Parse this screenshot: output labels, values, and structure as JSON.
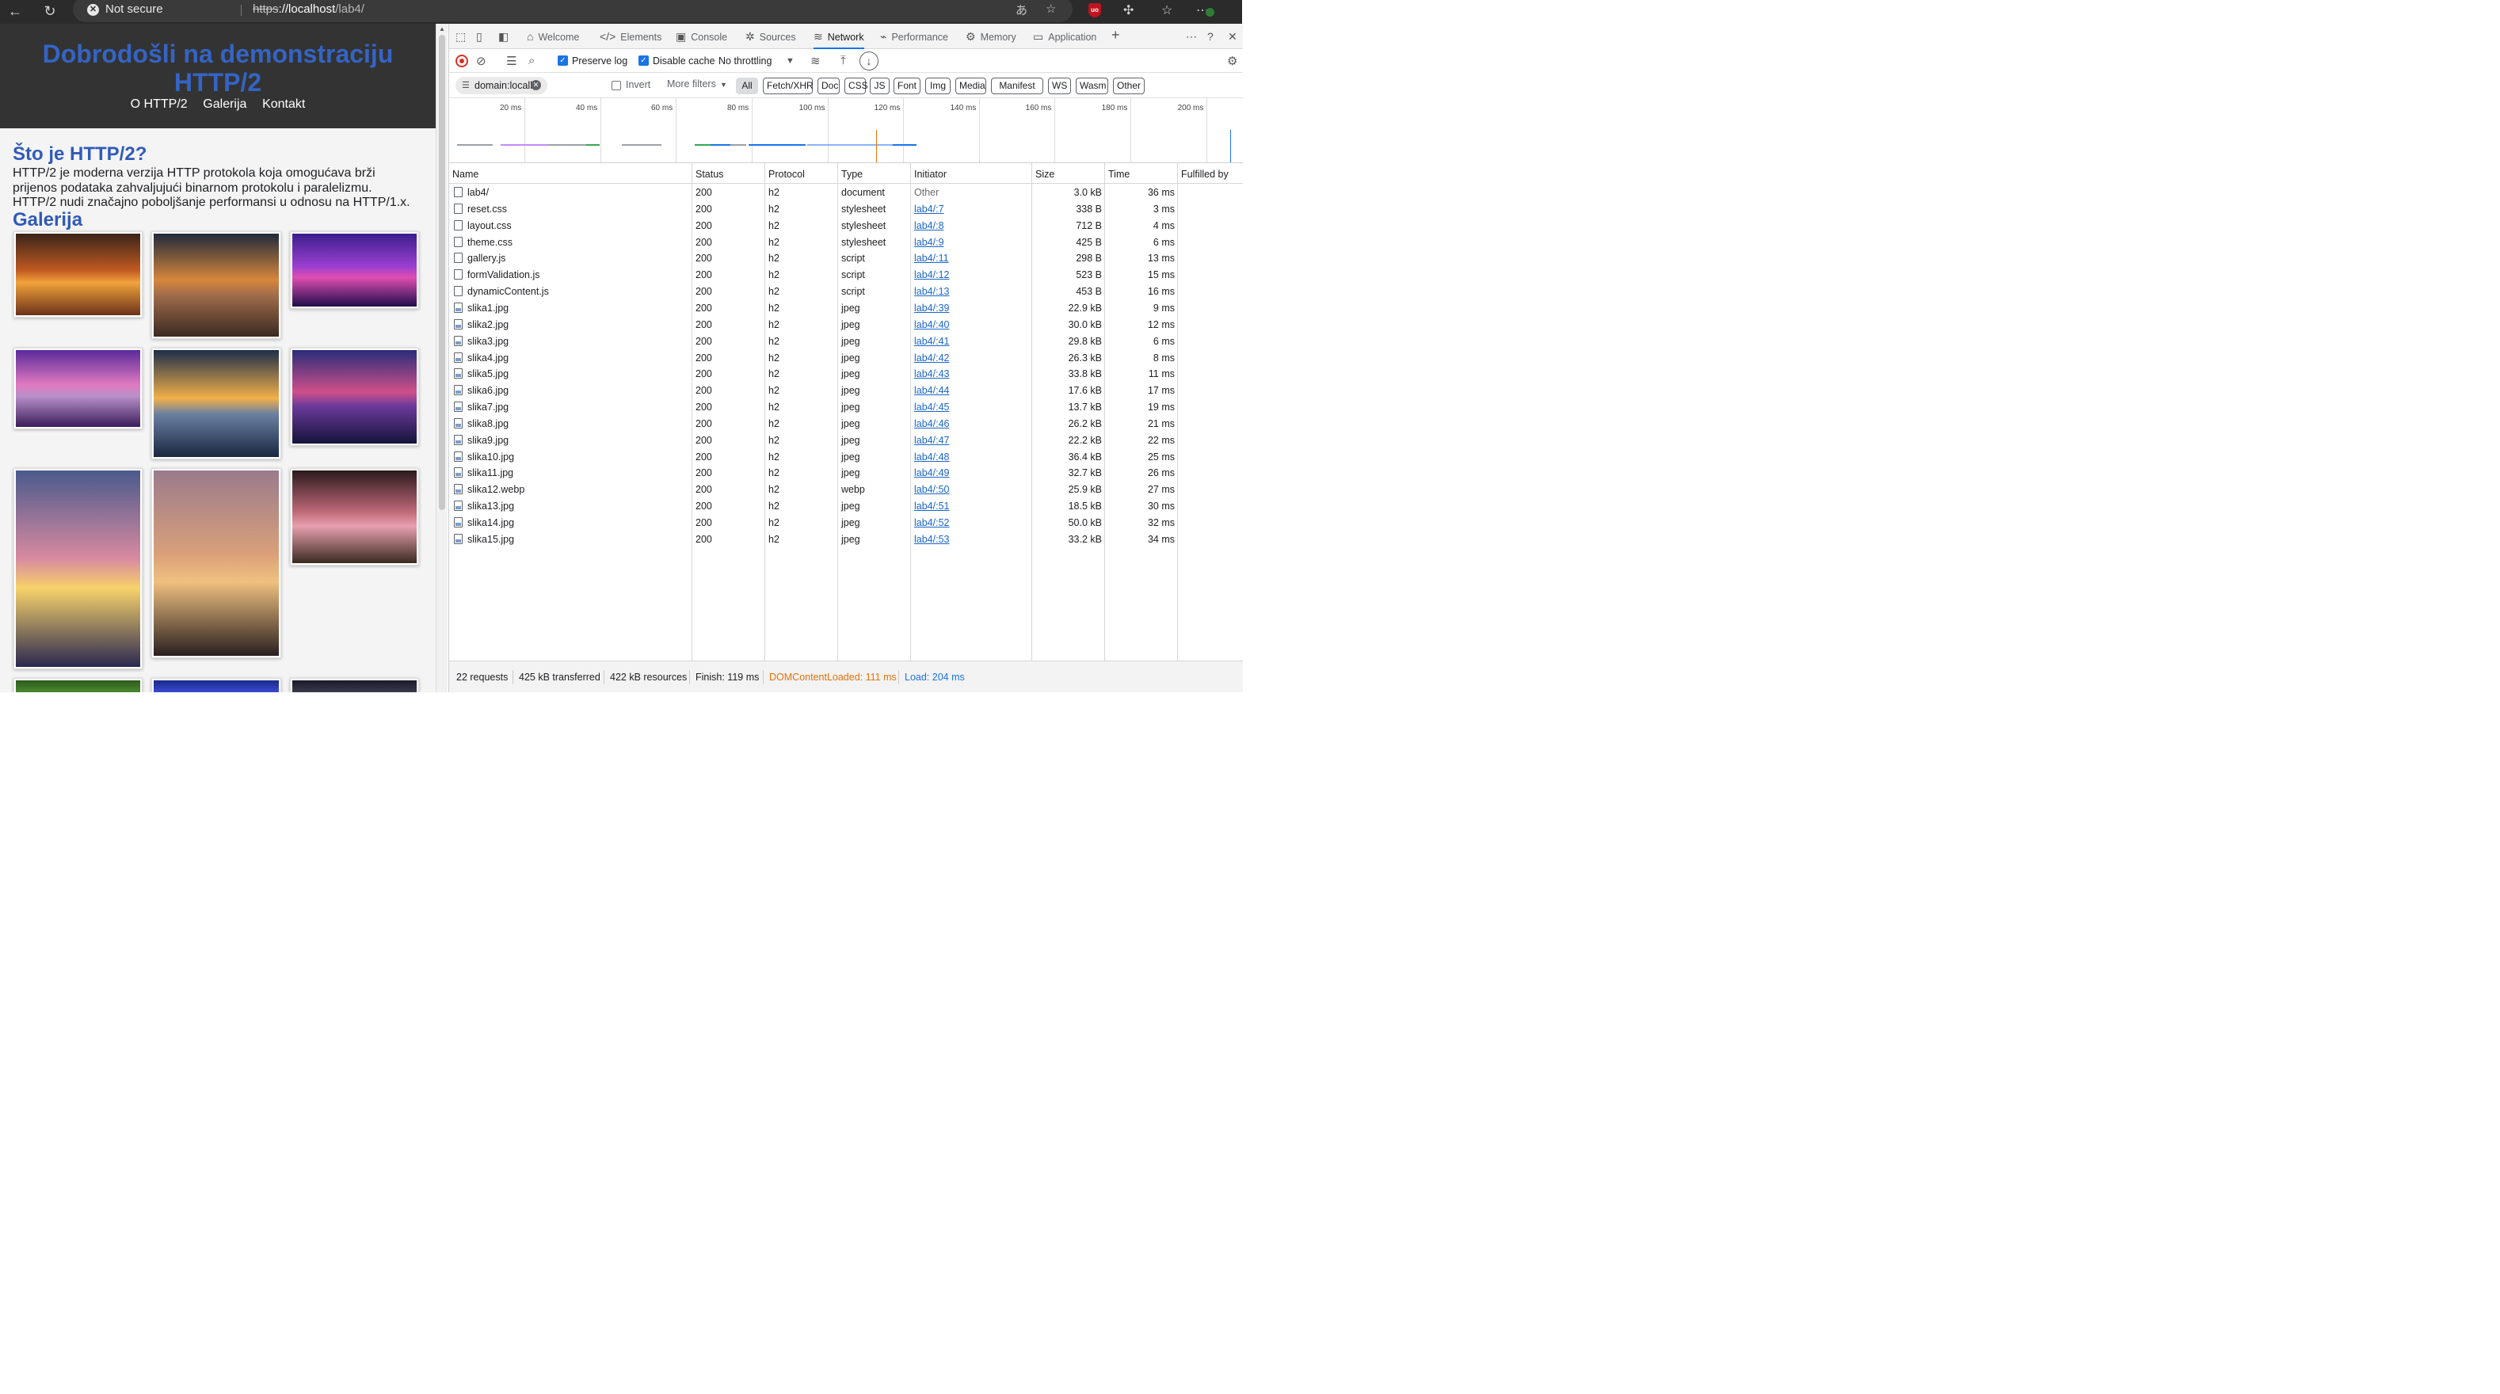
{
  "browser": {
    "security_label": "Not secure",
    "url_scheme": "https",
    "url_host": "://localhost",
    "url_path": "/lab4/",
    "translate_icon": "あ"
  },
  "site": {
    "title": "Dobrodošli na demonstraciju HTTP/2",
    "nav": [
      "O HTTP/2",
      "Galerija",
      "Kontakt"
    ],
    "section1_title": "Što je HTTP/2?",
    "section1_text": "HTTP/2 je moderna verzija HTTP protokola koja omogućava brži prijenos podataka zahvaljujući binarnom protokolu i paralelizmu. HTTP/2 nudi značajno poboljšanje performansi u odnosu na HTTP/1.x.",
    "section2_title": "Galerija",
    "gallery": [
      {
        "name": "gallery-image-sunset-valley",
        "colors": [
          "#3a2418",
          "#c15a22",
          "#f1a23c",
          "#6b3219"
        ]
      },
      {
        "name": "gallery-image-sunset-beach-rock",
        "colors": [
          "#1f2a3a",
          "#d8863c",
          "#9e6c4a",
          "#3b2a22"
        ]
      },
      {
        "name": "gallery-image-purple-tree",
        "colors": [
          "#3b1f8c",
          "#9b3fd1",
          "#e04eb3",
          "#1e0d4a"
        ]
      },
      {
        "name": "gallery-image-purple-beach",
        "colors": [
          "#5a2a9a",
          "#e07ac0",
          "#b890c8",
          "#3a1d5a"
        ]
      },
      {
        "name": "gallery-image-sunset-waves",
        "colors": [
          "#1d2e4a",
          "#f2b04a",
          "#6a7fa2",
          "#1a2840"
        ]
      },
      {
        "name": "gallery-image-purple-palm",
        "colors": [
          "#2a2c7a",
          "#d0508a",
          "#6a3a9a",
          "#14143a"
        ]
      },
      {
        "name": "gallery-image-sun-clouds",
        "colors": [
          "#4a5a8c",
          "#d88aa0",
          "#f7d26a",
          "#2a2850"
        ]
      },
      {
        "name": "gallery-image-tree-silhouette",
        "colors": [
          "#9a7a8c",
          "#d9a07a",
          "#f0c080",
          "#2a2020"
        ]
      },
      {
        "name": "gallery-image-rose",
        "colors": [
          "#2a1a1c",
          "#c06a7a",
          "#e8a0ae",
          "#3a2a20"
        ]
      }
    ]
  },
  "devtools": {
    "tabs": [
      {
        "label": "Welcome",
        "icon": "⌂"
      },
      {
        "label": "Elements",
        "icon": "</>"
      },
      {
        "label": "Console",
        "icon": "▣"
      },
      {
        "label": "Sources",
        "icon": "✲"
      },
      {
        "label": "Network",
        "icon": "≋"
      },
      {
        "label": "Performance",
        "icon": "⌁"
      },
      {
        "label": "Memory",
        "icon": "⚙"
      },
      {
        "label": "Application",
        "icon": "▭"
      }
    ],
    "active_tab": "Network",
    "toolbar": {
      "preserve_log": "Preserve log",
      "disable_cache": "Disable cache",
      "throttling": "No throttling"
    },
    "filter": {
      "value": "domain:locall",
      "invert": "Invert",
      "more_filters": "More filters",
      "types": [
        "All",
        "Fetch/XHR",
        "Doc",
        "CSS",
        "JS",
        "Font",
        "Img",
        "Media",
        "Manifest",
        "WS",
        "Wasm",
        "Other"
      ]
    },
    "timeline_labels": [
      "20 ms",
      "40 ms",
      "60 ms",
      "80 ms",
      "100 ms",
      "120 ms",
      "140 ms",
      "160 ms",
      "180 ms",
      "200 ms"
    ],
    "columns": [
      "Name",
      "Status",
      "Protocol",
      "Type",
      "Initiator",
      "Size",
      "Time",
      "Fulfilled by"
    ],
    "requests": [
      {
        "name": "lab4/",
        "status": "200",
        "protocol": "h2",
        "type": "document",
        "initiator": "Other",
        "size": "3.0 kB",
        "time": "36 ms",
        "icon": "doc"
      },
      {
        "name": "reset.css",
        "status": "200",
        "protocol": "h2",
        "type": "stylesheet",
        "initiator": "lab4/:7",
        "size": "338 B",
        "time": "3 ms",
        "icon": "css"
      },
      {
        "name": "layout.css",
        "status": "200",
        "protocol": "h2",
        "type": "stylesheet",
        "initiator": "lab4/:8",
        "size": "712 B",
        "time": "4 ms",
        "icon": "css"
      },
      {
        "name": "theme.css",
        "status": "200",
        "protocol": "h2",
        "type": "stylesheet",
        "initiator": "lab4/:9",
        "size": "425 B",
        "time": "6 ms",
        "icon": "css"
      },
      {
        "name": "gallery.js",
        "status": "200",
        "protocol": "h2",
        "type": "script",
        "initiator": "lab4/:11",
        "size": "298 B",
        "time": "13 ms",
        "icon": "js"
      },
      {
        "name": "formValidation.js",
        "status": "200",
        "protocol": "h2",
        "type": "script",
        "initiator": "lab4/:12",
        "size": "523 B",
        "time": "15 ms",
        "icon": "js"
      },
      {
        "name": "dynamicContent.js",
        "status": "200",
        "protocol": "h2",
        "type": "script",
        "initiator": "lab4/:13",
        "size": "453 B",
        "time": "16 ms",
        "icon": "js"
      },
      {
        "name": "slika1.jpg",
        "status": "200",
        "protocol": "h2",
        "type": "jpeg",
        "initiator": "lab4/:39",
        "size": "22.9 kB",
        "time": "9 ms",
        "icon": "img"
      },
      {
        "name": "slika2.jpg",
        "status": "200",
        "protocol": "h2",
        "type": "jpeg",
        "initiator": "lab4/:40",
        "size": "30.0 kB",
        "time": "12 ms",
        "icon": "img"
      },
      {
        "name": "slika3.jpg",
        "status": "200",
        "protocol": "h2",
        "type": "jpeg",
        "initiator": "lab4/:41",
        "size": "29.8 kB",
        "time": "6 ms",
        "icon": "img"
      },
      {
        "name": "slika4.jpg",
        "status": "200",
        "protocol": "h2",
        "type": "jpeg",
        "initiator": "lab4/:42",
        "size": "26.3 kB",
        "time": "8 ms",
        "icon": "img"
      },
      {
        "name": "slika5.jpg",
        "status": "200",
        "protocol": "h2",
        "type": "jpeg",
        "initiator": "lab4/:43",
        "size": "33.8 kB",
        "time": "11 ms",
        "icon": "img"
      },
      {
        "name": "slika6.jpg",
        "status": "200",
        "protocol": "h2",
        "type": "jpeg",
        "initiator": "lab4/:44",
        "size": "17.6 kB",
        "time": "17 ms",
        "icon": "img"
      },
      {
        "name": "slika7.jpg",
        "status": "200",
        "protocol": "h2",
        "type": "jpeg",
        "initiator": "lab4/:45",
        "size": "13.7 kB",
        "time": "19 ms",
        "icon": "img"
      },
      {
        "name": "slika8.jpg",
        "status": "200",
        "protocol": "h2",
        "type": "jpeg",
        "initiator": "lab4/:46",
        "size": "26.2 kB",
        "time": "21 ms",
        "icon": "img"
      },
      {
        "name": "slika9.jpg",
        "status": "200",
        "protocol": "h2",
        "type": "jpeg",
        "initiator": "lab4/:47",
        "size": "22.2 kB",
        "time": "22 ms",
        "icon": "img"
      },
      {
        "name": "slika10.jpg",
        "status": "200",
        "protocol": "h2",
        "type": "jpeg",
        "initiator": "lab4/:48",
        "size": "36.4 kB",
        "time": "25 ms",
        "icon": "img"
      },
      {
        "name": "slika11.jpg",
        "status": "200",
        "protocol": "h2",
        "type": "jpeg",
        "initiator": "lab4/:49",
        "size": "32.7 kB",
        "time": "26 ms",
        "icon": "img"
      },
      {
        "name": "slika12.webp",
        "status": "200",
        "protocol": "h2",
        "type": "webp",
        "initiator": "lab4/:50",
        "size": "25.9 kB",
        "time": "27 ms",
        "icon": "img"
      },
      {
        "name": "slika13.jpg",
        "status": "200",
        "protocol": "h2",
        "type": "jpeg",
        "initiator": "lab4/:51",
        "size": "18.5 kB",
        "time": "30 ms",
        "icon": "img"
      },
      {
        "name": "slika14.jpg",
        "status": "200",
        "protocol": "h2",
        "type": "jpeg",
        "initiator": "lab4/:52",
        "size": "50.0 kB",
        "time": "32 ms",
        "icon": "img"
      },
      {
        "name": "slika15.jpg",
        "status": "200",
        "protocol": "h2",
        "type": "jpeg",
        "initiator": "lab4/:53",
        "size": "33.2 kB",
        "time": "34 ms",
        "icon": "img"
      }
    ],
    "status_bar": {
      "requests": "22 requests",
      "transferred": "425 kB transferred",
      "resources": "422 kB resources",
      "finish": "Finish: 119 ms",
      "dom_content_loaded": "DOMContentLoaded: 111 ms",
      "load": "Load: 204 ms"
    },
    "colors": {
      "accent": "#1a73e8",
      "record": "#d93025",
      "dom_content_loaded": "#e8710a",
      "load": "#1a73e8",
      "link": "#1a66c9"
    }
  }
}
